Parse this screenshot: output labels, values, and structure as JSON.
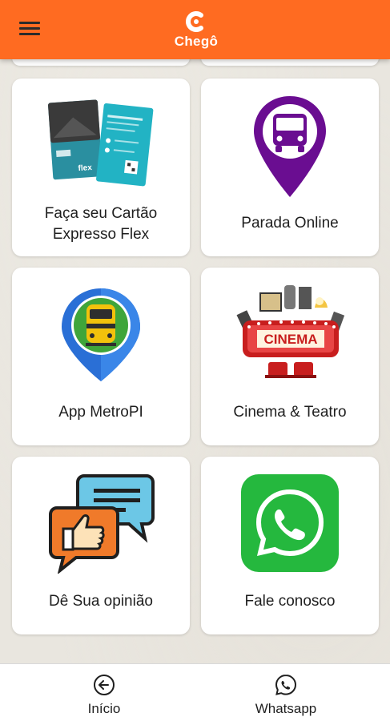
{
  "header": {
    "menu_icon": "hamburger-menu-icon",
    "logo_text": "Chegô",
    "brand_color": "#ff6b21"
  },
  "cards": [
    {
      "label_line1": "Faça seu Cartão",
      "label_line2": "Expresso Flex",
      "icon": "expresso-flex-cards-icon"
    },
    {
      "label": "Parada Online",
      "icon": "bus-pin-icon",
      "color": "#6a0d91"
    },
    {
      "label": "App MetroPI",
      "icon": "metro-pin-icon",
      "color": "#2a6fd6"
    },
    {
      "label": "Cinema & Teatro",
      "icon": "cinema-icon"
    },
    {
      "label": "Dê Sua opinião",
      "icon": "feedback-chat-icon"
    },
    {
      "label": "Fale conosco",
      "icon": "whatsapp-icon",
      "color": "#25b83e"
    }
  ],
  "bottom_nav": {
    "home": {
      "label": "Início",
      "icon": "back-arrow-circle-icon"
    },
    "whatsapp": {
      "label": "Whatsapp",
      "icon": "whatsapp-outline-icon"
    }
  }
}
